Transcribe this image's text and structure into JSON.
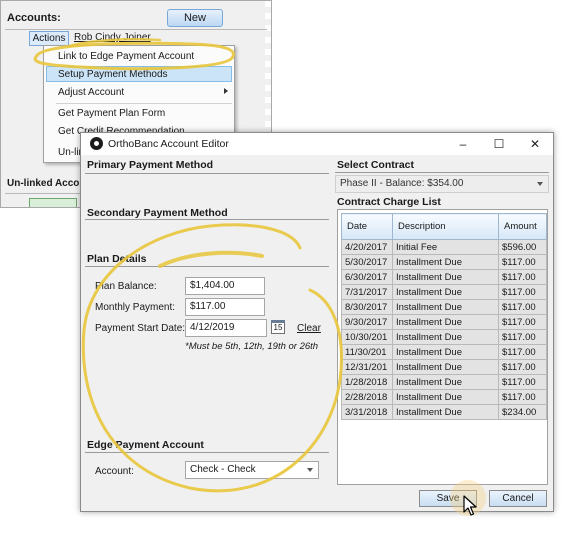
{
  "accounts_panel": {
    "title": "Accounts:",
    "new_button": "New",
    "actions_button": "Actions",
    "patient_names": "Rob  Cindy Joiner",
    "menu": {
      "link_edge": "Link to Edge Payment Account",
      "setup_payment": "Setup Payment Methods",
      "adjust_account": "Adjust Account",
      "payment_plan_form": "Get Payment Plan Form",
      "credit_recommendation": "Get Credit Recommendation",
      "unlink": "Un-link"
    },
    "unlinked_label": "Un-linked Accounts"
  },
  "dialog": {
    "title": "OrthoBanc Account Editor",
    "window_buttons": {
      "minimize": "–",
      "maximize": "☐",
      "close": "✕"
    },
    "primary_payment_method": "Primary Payment Method",
    "secondary_payment_method": "Secondary Payment Method",
    "plan_details": {
      "header": "Plan Details",
      "plan_balance_label": "Plan Balance:",
      "plan_balance_value": "$1,404.00",
      "monthly_payment_label": "Monthly Payment:",
      "monthly_payment_value": "$117.00",
      "start_date_label": "Payment Start Date:",
      "start_date_value": "4/12/2019",
      "calendar_glyph": "15",
      "clear_link": "Clear",
      "hint": "*Must be 5th, 12th, 19th or 26th"
    },
    "edge_payment_account": {
      "header": "Edge Payment Account",
      "account_label": "Account:",
      "account_value": "Check - Check"
    },
    "select_contract": {
      "header": "Select Contract",
      "value": "Phase II  - Balance: $354.00"
    },
    "charge_list": {
      "header": "Contract Charge List",
      "columns": [
        "Date",
        "Description",
        "Amount"
      ],
      "rows": [
        [
          "4/20/2017",
          "Initial Fee",
          "$596.00"
        ],
        [
          "5/30/2017",
          "Installment Due",
          "$117.00"
        ],
        [
          "6/30/2017",
          "Installment Due",
          "$117.00"
        ],
        [
          "7/31/2017",
          "Installment Due",
          "$117.00"
        ],
        [
          "8/30/2017",
          "Installment Due",
          "$117.00"
        ],
        [
          "9/30/2017",
          "Installment Due",
          "$117.00"
        ],
        [
          "10/30/201",
          "Installment Due",
          "$117.00"
        ],
        [
          "11/30/201",
          "Installment Due",
          "$117.00"
        ],
        [
          "12/31/201",
          "Installment Due",
          "$117.00"
        ],
        [
          "1/28/2018",
          "Installment Due",
          "$117.00"
        ],
        [
          "2/28/2018",
          "Installment Due",
          "$117.00"
        ],
        [
          "3/31/2018",
          "Installment Due",
          "$234.00"
        ]
      ]
    },
    "save_button": "Save",
    "cancel_button": "Cancel"
  },
  "colors": {
    "annotation_yellow": "#e8c53a",
    "button_blue": "#c9def3",
    "highlight_blue": "#cce4f7"
  }
}
